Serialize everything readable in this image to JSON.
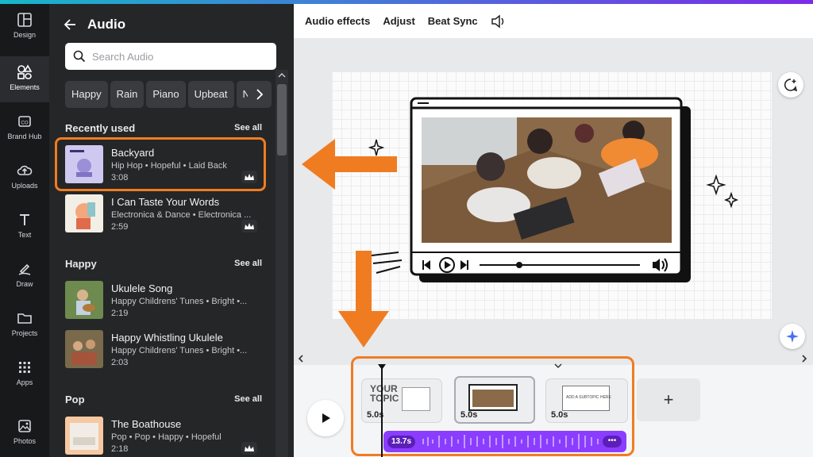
{
  "rail": {
    "items": [
      {
        "label": "Design",
        "icon": "layout-icon"
      },
      {
        "label": "Elements",
        "icon": "shapes-icon",
        "active": true
      },
      {
        "label": "Brand Hub",
        "icon": "brand-icon"
      },
      {
        "label": "Uploads",
        "icon": "upload-cloud-icon"
      },
      {
        "label": "Text",
        "icon": "text-icon"
      },
      {
        "label": "Draw",
        "icon": "pen-icon"
      },
      {
        "label": "Projects",
        "icon": "folder-icon"
      },
      {
        "label": "Apps",
        "icon": "grid-icon"
      },
      {
        "label": "Photos",
        "icon": "image-icon"
      }
    ]
  },
  "panel": {
    "title": "Audio",
    "search_placeholder": "Search Audio",
    "chips": [
      "Happy",
      "Rain",
      "Piano",
      "Upbeat",
      "Ne"
    ],
    "sections": [
      {
        "label": "Recently used",
        "see_all": "See all",
        "tracks": [
          {
            "title": "Backyard",
            "meta": "Hip Hop • Hopeful • Laid Back",
            "duration": "3:08"
          },
          {
            "title": "I Can Taste Your Words",
            "meta": "Electronica & Dance • Electronica ...",
            "duration": "2:59"
          }
        ]
      },
      {
        "label": "Happy",
        "see_all": "See all",
        "tracks": [
          {
            "title": "Ukulele Song",
            "meta": "Happy Childrens' Tunes • Bright •...",
            "duration": "2:19"
          },
          {
            "title": "Happy Whistling Ukulele",
            "meta": "Happy Childrens' Tunes • Bright •...",
            "duration": "2:03"
          }
        ]
      },
      {
        "label": "Pop",
        "see_all": "See all",
        "tracks": [
          {
            "title": "The Boathouse",
            "meta": "Pop • Pop • Happy • Hopeful",
            "duration": "2:18"
          }
        ]
      }
    ]
  },
  "toolbar": {
    "audio_effects": "Audio effects",
    "adjust": "Adjust",
    "beat_sync": "Beat Sync"
  },
  "timeline": {
    "clips": [
      {
        "duration": "5.0s",
        "thumb_text": "YOUR TOPIC"
      },
      {
        "duration": "5.0s"
      },
      {
        "duration": "5.0s",
        "thumb_text": "ADD A SUBTOPIC HERE"
      }
    ],
    "audio_duration": "13.7s",
    "add_label": "+"
  },
  "colors": {
    "accent_orange": "#f07c22",
    "audio_purple": "#8b3dff",
    "panel_bg": "#252627",
    "rail_bg": "#18191b"
  }
}
